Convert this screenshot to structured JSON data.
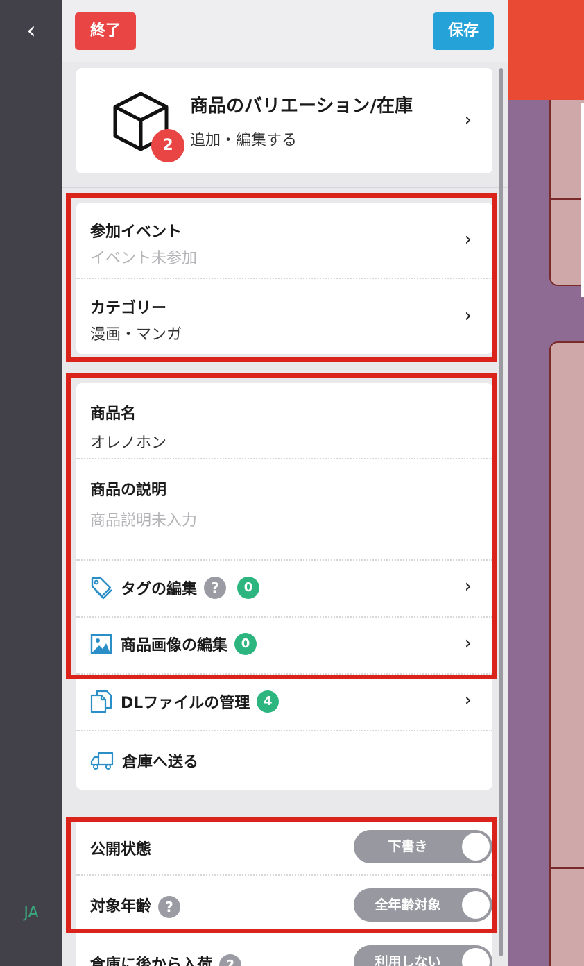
{
  "nav": {
    "back_glyph": "‹",
    "language": "JA"
  },
  "header": {
    "end_button": "終了",
    "save_button": "保存"
  },
  "variation": {
    "title": "商品のバリエーション/在庫",
    "subtitle": "追加・編集する",
    "badge": "2"
  },
  "event": {
    "label": "参加イベント",
    "value": "イベント未参加"
  },
  "category": {
    "label": "カテゴリー",
    "value": "漫画・マンガ"
  },
  "product_name": {
    "label": "商品名",
    "value": "オレノホン"
  },
  "description": {
    "label": "商品の説明",
    "value": "商品説明未入力"
  },
  "tags": {
    "label": "タグの編集",
    "help": "?",
    "count": "0"
  },
  "images": {
    "label": "商品画像の編集",
    "count": "0"
  },
  "dl_files": {
    "label": "DLファイルの管理",
    "count": "4"
  },
  "warehouse_send": {
    "label": "倉庫へ送る"
  },
  "publish": {
    "label": "公開状態",
    "toggle": "下書き"
  },
  "age": {
    "label": "対象年齢",
    "help": "?",
    "toggle": "全年齢対象"
  },
  "warehouse_later": {
    "label": "倉庫に後から入荷",
    "help": "?",
    "toggle": "利用しない"
  },
  "colors": {
    "accent_red": "#e94545",
    "save_blue": "#25a3d9",
    "badge_green": "#2cb57f",
    "highlight_red": "#d9231b"
  }
}
